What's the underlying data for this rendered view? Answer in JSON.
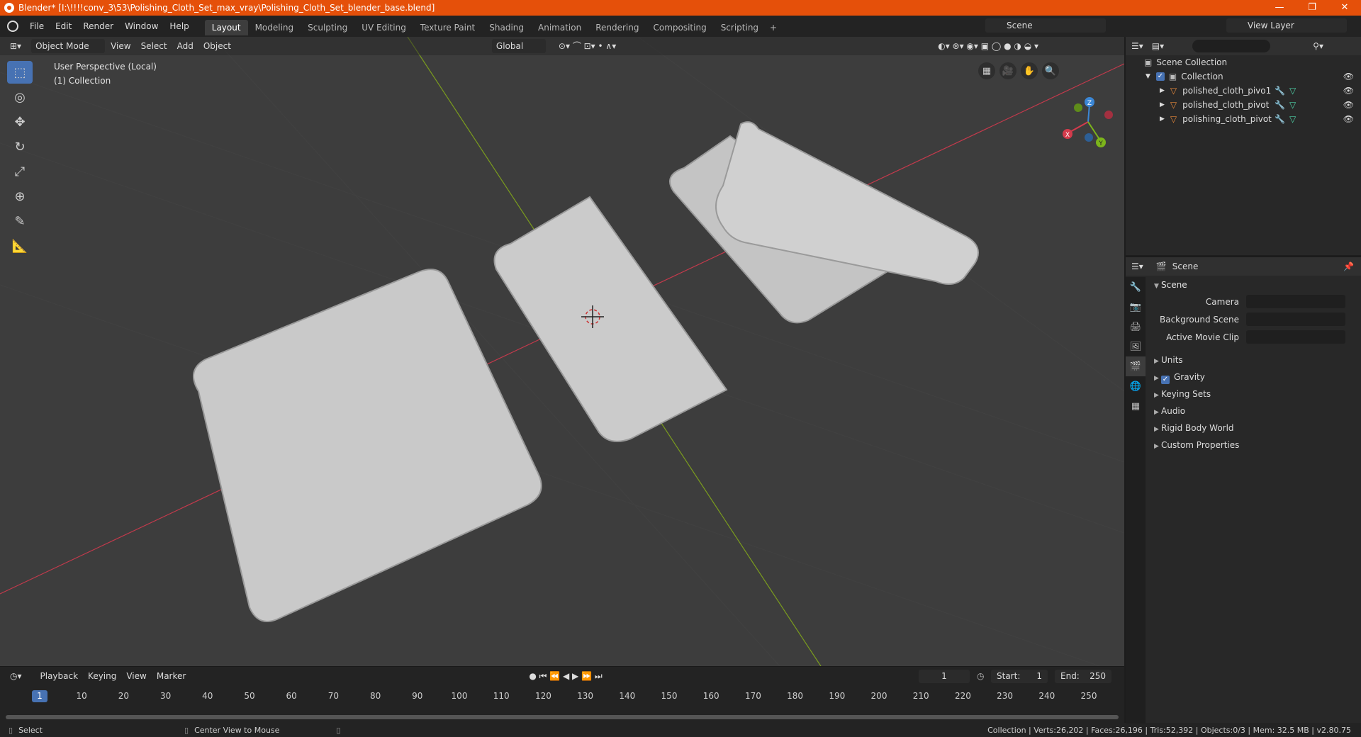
{
  "window": {
    "title": "Blender* [I:\\!!!!conv_3\\53\\Polishing_Cloth_Set_max_vray\\Polishing_Cloth_Set_blender_base.blend]",
    "minimize": "—",
    "maximize": "❐",
    "close": "✕"
  },
  "menu": [
    "File",
    "Edit",
    "Render",
    "Window",
    "Help"
  ],
  "workspaces": [
    "Layout",
    "Modeling",
    "Sculpting",
    "UV Editing",
    "Texture Paint",
    "Shading",
    "Animation",
    "Rendering",
    "Compositing",
    "Scripting"
  ],
  "workspace_add": "+",
  "scene_name": "Scene",
  "view_layer": "View Layer",
  "viewport": {
    "mode": "Object Mode",
    "menus": [
      "View",
      "Select",
      "Add",
      "Object"
    ],
    "orientation": "Global",
    "perspective": "User Perspective (Local)",
    "collection": "(1) Collection",
    "gizmo": {
      "x": "X",
      "y": "Y",
      "z": "Z"
    }
  },
  "timeline": {
    "menus": [
      "Playback",
      "Keying",
      "View",
      "Marker"
    ],
    "current_frame": "1",
    "start_label": "Start:",
    "start": "1",
    "end_label": "End:",
    "end": "250",
    "ticks": [
      "10",
      "20",
      "30",
      "40",
      "50",
      "60",
      "70",
      "80",
      "90",
      "100",
      "110",
      "120",
      "130",
      "140",
      "150",
      "160",
      "170",
      "180",
      "190",
      "200",
      "210",
      "220",
      "230",
      "240",
      "250"
    ]
  },
  "outliner": {
    "root": "Scene Collection",
    "collection": "Collection",
    "objects": [
      "polished_cloth_pivo1",
      "polished_cloth_pivot",
      "polishing_cloth_pivot"
    ]
  },
  "properties": {
    "header": "Scene",
    "panel": "Scene",
    "camera_label": "Camera",
    "bg_scene_label": "Background Scene",
    "movie_clip_label": "Active Movie Clip",
    "subpanels": [
      "Units",
      "Gravity",
      "Keying Sets",
      "Audio",
      "Rigid Body World",
      "Custom Properties"
    ]
  },
  "status": {
    "select": "Select",
    "center": "Center View to Mouse",
    "stats": "Collection | Verts:26,202 | Faces:26,196 | Tris:52,392 | Objects:0/3 | Mem: 32.5 MB | v2.80.75"
  },
  "colors": {
    "title_bar": "#e5500a",
    "accent": "#4772b3",
    "x_axis": "#c33a4c",
    "y_axis": "#7a9c1e"
  }
}
